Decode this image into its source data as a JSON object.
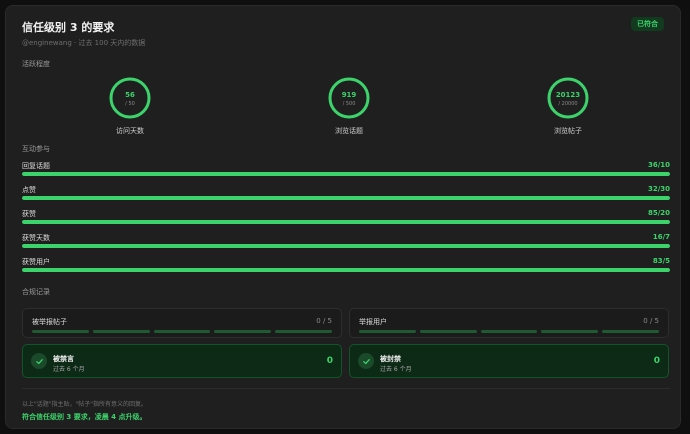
{
  "header": {
    "title": "信任级别 3 的要求",
    "badge": "已符合",
    "subtitle": "@enginewang · 过去 100 天内的数据"
  },
  "activity": {
    "label": "活跃程度",
    "rings": [
      {
        "value": "56",
        "total": "/ 50",
        "label": "访问天数",
        "fraction": 1.0
      },
      {
        "value": "919",
        "total": "/ 500",
        "label": "浏览话题",
        "fraction": 1.0
      },
      {
        "value": "20123",
        "total": "/ 20000",
        "label": "浏览帖子",
        "fraction": 1.0
      }
    ]
  },
  "interaction": {
    "label": "互动参与",
    "bars": [
      {
        "label": "回复话题",
        "value": "36/10",
        "fraction": 1.0
      },
      {
        "label": "点赞",
        "value": "32/30",
        "fraction": 1.0
      },
      {
        "label": "获赞",
        "value": "85/20",
        "fraction": 1.0
      },
      {
        "label": "获赞天数",
        "value": "16/7",
        "fraction": 1.0
      },
      {
        "label": "获赞用户",
        "value": "83/5",
        "fraction": 1.0
      }
    ]
  },
  "compliance": {
    "label": "合规记录",
    "reports": [
      {
        "label": "被举报帖子",
        "value": "0 / 5"
      },
      {
        "label": "举报用户",
        "value": "0 / 5"
      }
    ],
    "bans": [
      {
        "title": "被禁言",
        "sub": "过去 6 个月",
        "value": "0"
      },
      {
        "title": "被封禁",
        "sub": "过去 6 个月",
        "value": "0"
      }
    ]
  },
  "footer": {
    "note": "以上\"话题\"指主贴，\"帖子\"指所有意义的回复。",
    "result": "符合信任级别 3 要求，凌晨 4 点升级。"
  },
  "colors": {
    "accent": "#3dd36b",
    "card": "#1f1f1f",
    "track": "#2c2c2c"
  }
}
